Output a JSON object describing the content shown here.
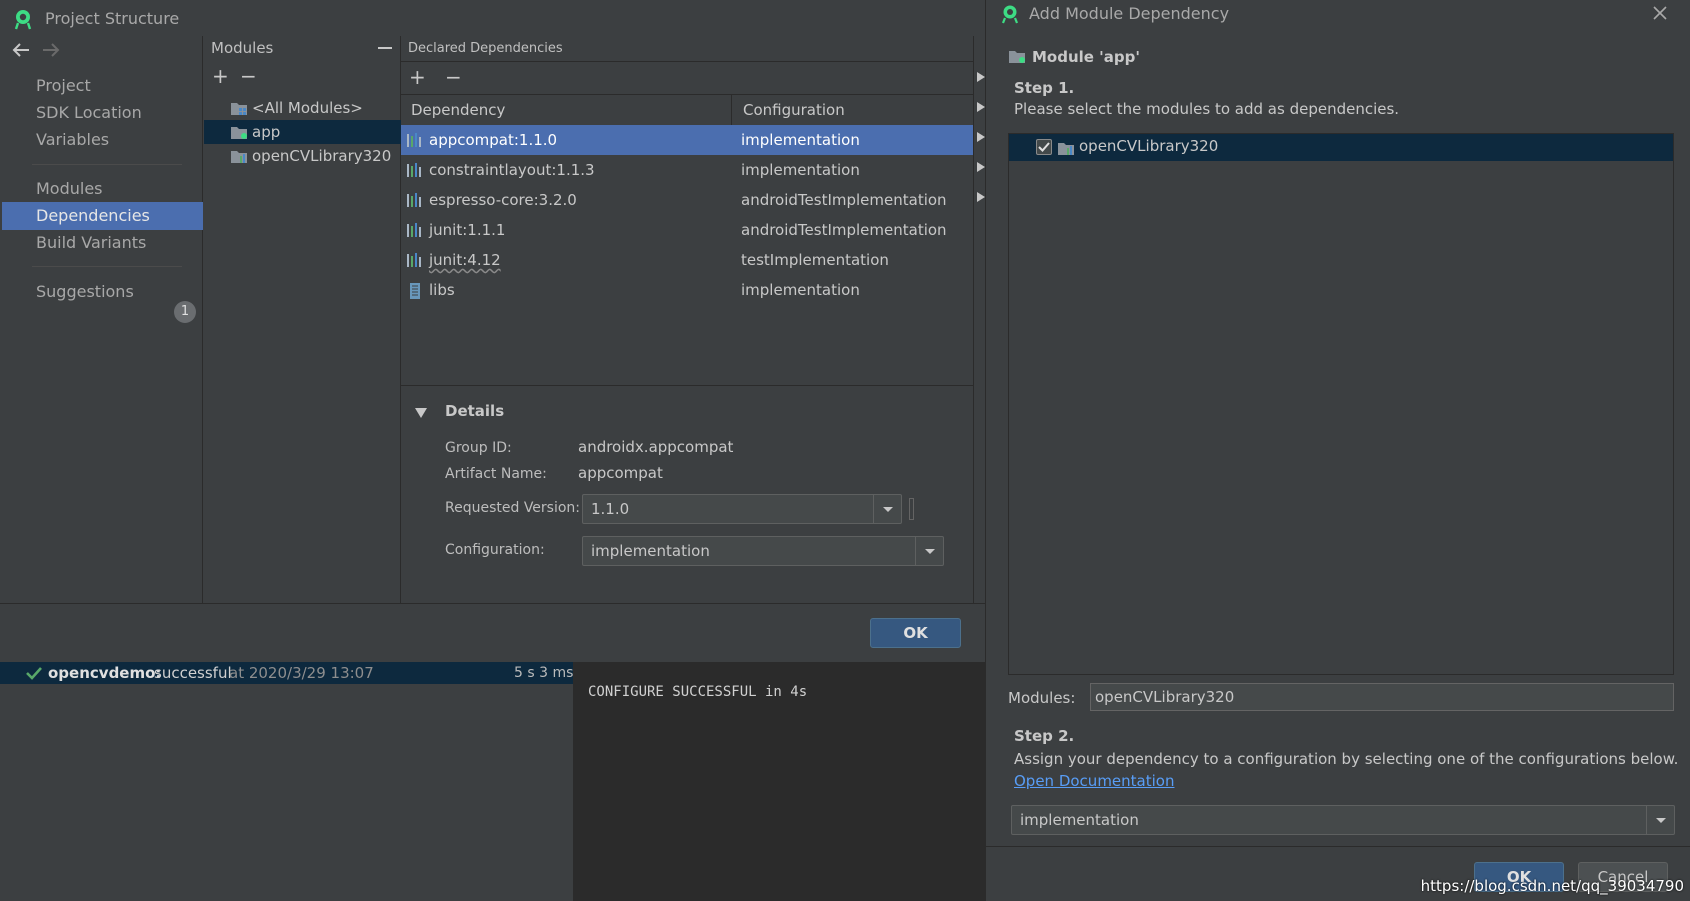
{
  "project_structure": {
    "title": "Project Structure",
    "nav": {
      "items": [
        {
          "label": "Project"
        },
        {
          "label": "SDK Location"
        },
        {
          "label": "Variables"
        },
        {
          "label": "Modules"
        },
        {
          "label": "Dependencies"
        },
        {
          "label": "Build Variants"
        },
        {
          "label": "Suggestions",
          "badge": "1"
        }
      ],
      "selected": "Dependencies"
    },
    "modules": {
      "header": "Modules",
      "add": "+",
      "remove": "−",
      "items": [
        {
          "label": "<All Modules>"
        },
        {
          "label": "app"
        },
        {
          "label": "openCVLibrary320"
        }
      ],
      "selected": "app"
    },
    "declared_dependencies": {
      "header": "Declared Dependencies",
      "add": "+",
      "remove": "−",
      "columns": [
        "Dependency",
        "Configuration"
      ],
      "rows": [
        {
          "name": "appcompat:1.1.0",
          "config": "implementation"
        },
        {
          "name": "constraintlayout:1.1.3",
          "config": "implementation"
        },
        {
          "name": "espresso-core:3.2.0",
          "config": "androidTestImplementation"
        },
        {
          "name": "junit:1.1.1",
          "config": "androidTestImplementation"
        },
        {
          "name": "junit:4.12",
          "config": "testImplementation"
        },
        {
          "name": "libs",
          "config": "implementation"
        }
      ],
      "selected": "appcompat:1.1.0"
    },
    "details": {
      "header": "Details",
      "group_id_label": "Group ID:",
      "group_id": "androidx.appcompat",
      "artifact_label": "Artifact Name:",
      "artifact": "appcompat",
      "requested_version_label": "Requested Version:",
      "requested_version": "1.1.0",
      "configuration_label": "Configuration:",
      "configuration": "implementation"
    },
    "ok_label": "OK"
  },
  "build": {
    "project": "opencvdemo:",
    "status": " successful",
    "at": " at 2020/3/29 13:07",
    "duration": "5 s 3 ms",
    "console": "CONFIGURE SUCCESSFUL in 4s"
  },
  "add_module_dependency": {
    "title": "Add Module Dependency",
    "module_title": "Module 'app'",
    "step1_title": "Step 1.",
    "step1_text": "Please select the modules to add as dependencies.",
    "list": [
      {
        "label": "openCVLibrary320",
        "checked": true
      }
    ],
    "modules_label": "Modules:",
    "modules_value": "openCVLibrary320",
    "step2_title": "Step 2.",
    "step2_text": "Assign your dependency to a configuration by selecting one of the configurations below.",
    "open_doc": "Open Documentation",
    "configuration": "implementation",
    "ok_label": "OK",
    "cancel_label": "Cancel"
  },
  "watermark": "https://blog.csdn.net/qq_39034790",
  "colors": {
    "selection": "#4b6eaf",
    "tree_selection": "#0d293e",
    "success": "#59a869",
    "link": "#589df6",
    "panel": "#3c3f41"
  }
}
